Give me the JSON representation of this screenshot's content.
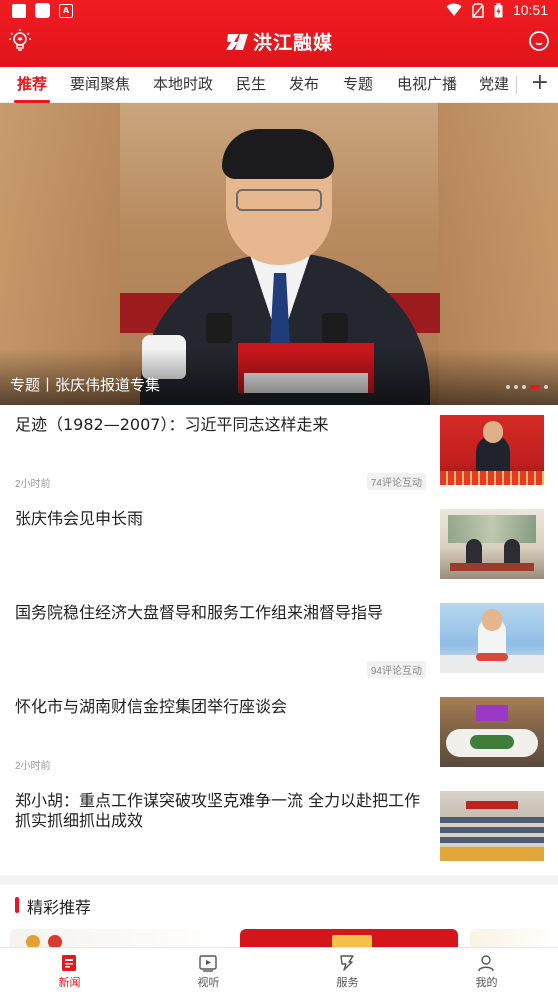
{
  "status_bar": {
    "time": "10:51",
    "left_icons": [
      "news-app-icon",
      "square-app-icon",
      "a-app-icon"
    ],
    "right_icons": [
      "wifi-icon",
      "no-sim-icon",
      "battery-icon"
    ]
  },
  "header": {
    "brand_name": "洪江融媒",
    "left_icon": "lightbulb-icon",
    "right_icon": "search-icon",
    "color": "#e6171d"
  },
  "tabs": {
    "items": [
      {
        "label": "推荐",
        "active": true
      },
      {
        "label": "要闻聚焦"
      },
      {
        "label": "本地时政"
      },
      {
        "label": "民生"
      },
      {
        "label": "发布"
      },
      {
        "label": "专题"
      },
      {
        "label": "电视广播"
      },
      {
        "label": "党建"
      }
    ],
    "add_label": "+"
  },
  "banner": {
    "caption": "专题丨张庆伟报道专集",
    "pager": {
      "count": 5,
      "active_index": 3
    }
  },
  "news": [
    {
      "title": "足迹（1982—2007）：习近平同志这样走来",
      "time": "2小时前",
      "comments": "74评论互动"
    },
    {
      "title": "张庆伟会见申长雨",
      "time": "",
      "comments": ""
    },
    {
      "title": "国务院稳住经济大盘督导和服务工作组来湘督导指导",
      "time": "",
      "comments": "94评论互动"
    },
    {
      "title": "怀化市与湖南财信金控集团举行座谈会",
      "time": "2小时前",
      "comments": ""
    },
    {
      "title": "郑小胡：重点工作谋突破攻坚克难争一流 全力以赴把工作抓实抓细抓出成效",
      "time": "",
      "comments": ""
    }
  ],
  "featured": {
    "title": "精彩推荐"
  },
  "bottom_nav": {
    "items": [
      {
        "label": "新闻",
        "icon": "newspaper-icon",
        "active": true
      },
      {
        "label": "视听",
        "icon": "video-play-icon"
      },
      {
        "label": "服务",
        "icon": "service-icon"
      },
      {
        "label": "我的",
        "icon": "user-icon"
      }
    ]
  },
  "colors": {
    "accent": "#e6171d",
    "text": "#222222",
    "muted": "#999999"
  }
}
